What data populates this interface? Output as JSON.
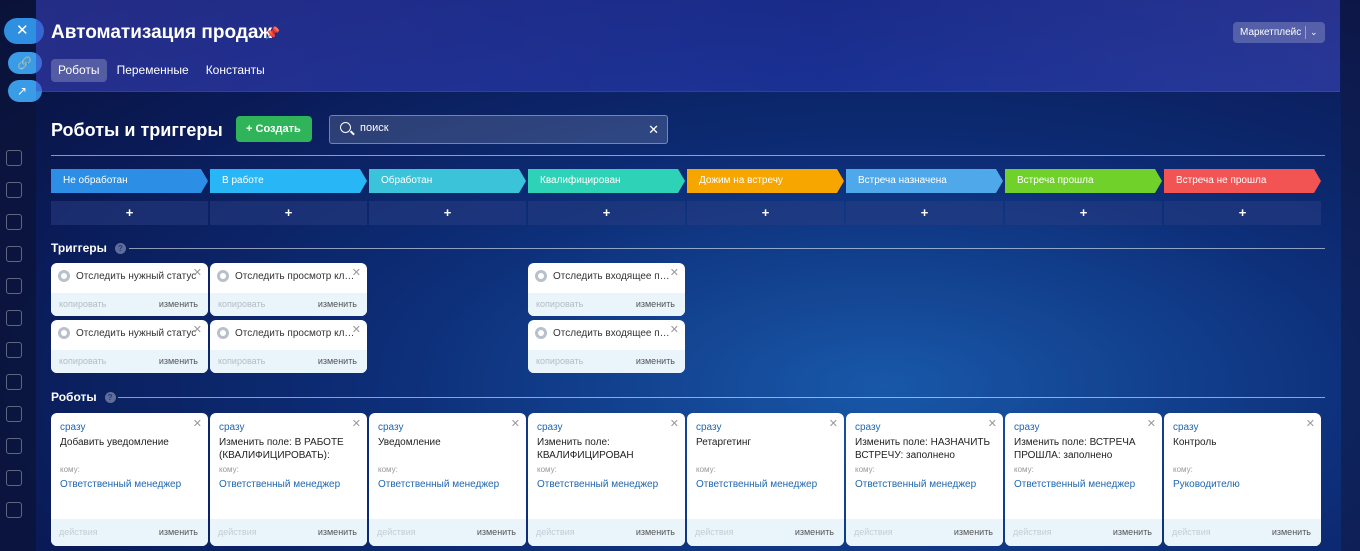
{
  "window": {
    "title": "Автоматизация продаж",
    "marketplace_label": "Маркетплейс"
  },
  "tabs": [
    {
      "label": "Роботы",
      "active": true
    },
    {
      "label": "Переменные",
      "active": false
    },
    {
      "label": "Константы",
      "active": false
    }
  ],
  "main": {
    "heading": "Роботы и триггеры",
    "create_label": "Создать",
    "search_placeholder": "поиск"
  },
  "stages": [
    {
      "label": "Не обработан",
      "color": "#2d8ee6",
      "text_color": "#ffffff"
    },
    {
      "label": "В работе",
      "color": "#29b6f6",
      "text_color": "#ffffff"
    },
    {
      "label": "Обработан",
      "color": "#3bc4d9",
      "text_color": "#ffffff"
    },
    {
      "label": "Квалифицирован",
      "color": "#2ed3b7",
      "text_color": "#ffffff"
    },
    {
      "label": "Дожим на встречу",
      "color": "#f7a600",
      "text_color": "#ffffff"
    },
    {
      "label": "Встреча назначена",
      "color": "#4ea8ea",
      "text_color": "#ffffff"
    },
    {
      "label": "Встреча прошла",
      "color": "#6fd12a",
      "text_color": "#ffffff"
    },
    {
      "label": "Встреча не прошла",
      "color": "#f25454",
      "text_color": "#ffffff"
    }
  ],
  "add_symbol": "+",
  "triggers": {
    "title": "Триггеры",
    "items": [
      {
        "col": 0,
        "row": 0,
        "name": "Отследить нужный статус",
        "copy": "копировать",
        "edit": "изменить"
      },
      {
        "col": 1,
        "row": 0,
        "name": "Отследить просмотр клиентом",
        "copy": "копировать",
        "edit": "изменить"
      },
      {
        "col": 3,
        "row": 0,
        "name": "Отследить входящее письмо",
        "copy": "копировать",
        "edit": "изменить"
      },
      {
        "col": 0,
        "row": 1,
        "name": "Отследить нужный статус",
        "copy": "копировать",
        "edit": "изменить"
      },
      {
        "col": 1,
        "row": 1,
        "name": "Отследить просмотр клиентом",
        "copy": "копировать",
        "edit": "изменить"
      },
      {
        "col": 3,
        "row": 1,
        "name": "Отследить входящее письмо",
        "copy": "копировать",
        "edit": "изменить"
      }
    ]
  },
  "robots": {
    "title": "Роботы",
    "items": [
      {
        "when": "сразу",
        "name": "Добавить уведомление",
        "to_label": "кому:",
        "to": "Ответственный менеджер",
        "actions": "действия",
        "edit": "изменить"
      },
      {
        "when": "сразу",
        "name": "Изменить поле: В РАБОТЕ (КВАЛИФИЦИРОВАТЬ):",
        "to_label": "кому:",
        "to": "Ответственный менеджер",
        "actions": "действия",
        "edit": "изменить"
      },
      {
        "when": "сразу",
        "name": "Уведомление",
        "to_label": "кому:",
        "to": "Ответственный менеджер",
        "actions": "действия",
        "edit": "изменить"
      },
      {
        "when": "сразу",
        "name": "Изменить поле: КВАЛИФИЦИРОВАН",
        "to_label": "кому:",
        "to": "Ответственный менеджер",
        "actions": "действия",
        "edit": "изменить"
      },
      {
        "when": "сразу",
        "name": "Ретаргетинг",
        "to_label": "кому:",
        "to": "Ответственный менеджер",
        "actions": "действия",
        "edit": "изменить"
      },
      {
        "when": "сразу",
        "name": "Изменить поле: НАЗНАЧИТЬ ВСТРЕЧУ: заполнено",
        "to_label": "кому:",
        "to": "Ответственный менеджер",
        "actions": "действия",
        "edit": "изменить"
      },
      {
        "when": "сразу",
        "name": "Изменить поле: ВСТРЕЧА ПРОШЛА: заполнено",
        "to_label": "кому:",
        "to": "Ответственный менеджер",
        "actions": "действия",
        "edit": "изменить"
      },
      {
        "when": "сразу",
        "name": "Контроль",
        "to_label": "кому:",
        "to": "Руководителю",
        "actions": "действия",
        "edit": "изменить"
      }
    ]
  }
}
